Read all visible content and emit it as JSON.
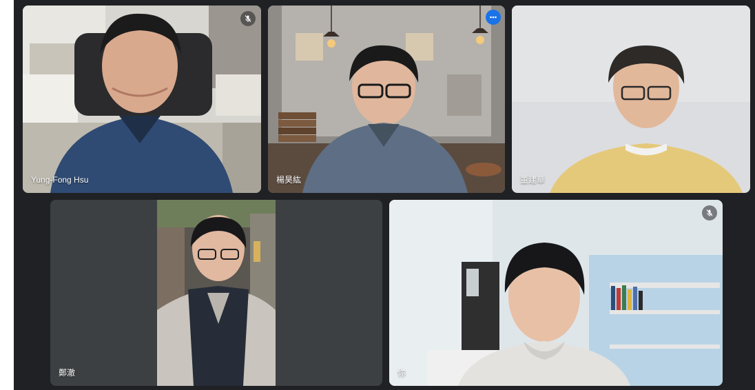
{
  "meeting": {
    "participants": [
      {
        "name": "Yung-Fong Hsu",
        "muted": true,
        "active": false
      },
      {
        "name": "楊昊紘",
        "muted": false,
        "active": true
      },
      {
        "name": "董建華",
        "muted": false,
        "active": false
      },
      {
        "name": "鄭澈",
        "muted": false,
        "active": false
      },
      {
        "name": "你",
        "muted": true,
        "active": false
      }
    ]
  },
  "icons": {
    "muted": "mic-off-icon",
    "more": "more-options-icon"
  },
  "colors": {
    "meeting_background": "#202124",
    "active_speaker_border": "#8ab4f8",
    "more_button": "#1a73e8",
    "tile_background": "#3c4043"
  }
}
